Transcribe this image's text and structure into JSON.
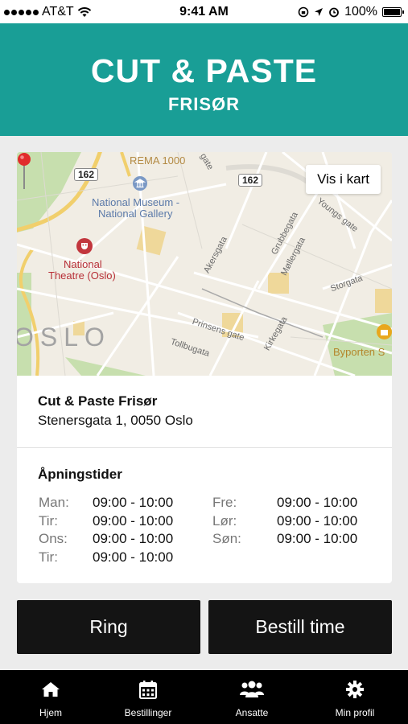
{
  "status_bar": {
    "carrier": "AT&T",
    "time": "9:41 AM",
    "battery": "100%"
  },
  "header": {
    "title": "CUT & PASTE",
    "subtitle": "FRISØR"
  },
  "map": {
    "button_label": "Vis i kart",
    "labels": {
      "rema": "REMA 1000",
      "museum_1": "National Museum -",
      "museum_2": "National Gallery",
      "theatre_1": "National",
      "theatre_2": "Theatre (Oslo)",
      "oslo": "OSLO",
      "road_1": "162",
      "road_2": "162",
      "akersgata": "Akersgata",
      "grubbegata": "Grubbegata",
      "mollergata": "Møllergata",
      "youngs": "Youngs gate",
      "storgata": "Storgata",
      "kirkegata": "Kirkegata",
      "prinsens": "Prinsens gate",
      "tollbugata": "Tollbugata",
      "byporten": "Byporten S",
      "gate": "gate"
    }
  },
  "location": {
    "name": "Cut & Paste Frisør",
    "address": "Stenersgata 1, 0050 Oslo"
  },
  "hours": {
    "title": "Åpningstider",
    "left": [
      {
        "day": "Man:",
        "time": "09:00 - 10:00"
      },
      {
        "day": "Tir:",
        "time": "09:00 - 10:00"
      },
      {
        "day": "Ons:",
        "time": "09:00 - 10:00"
      },
      {
        "day": "Tir:",
        "time": "09:00 - 10:00"
      }
    ],
    "right": [
      {
        "day": "Fre:",
        "time": "09:00 - 10:00"
      },
      {
        "day": "Lør:",
        "time": "09:00 - 10:00"
      },
      {
        "day": "Søn:",
        "time": "09:00 - 10:00"
      }
    ]
  },
  "actions": {
    "call_label": "Ring",
    "book_label": "Bestill time"
  },
  "tabs": [
    {
      "label": "Hjem",
      "icon": "home-icon"
    },
    {
      "label": "Bestillinger",
      "icon": "calendar-icon"
    },
    {
      "label": "Ansatte",
      "icon": "people-icon"
    },
    {
      "label": "Min profil",
      "icon": "gear-icon"
    }
  ],
  "colors": {
    "brand": "#199e96",
    "button": "#141414",
    "tabbar": "#000000"
  }
}
